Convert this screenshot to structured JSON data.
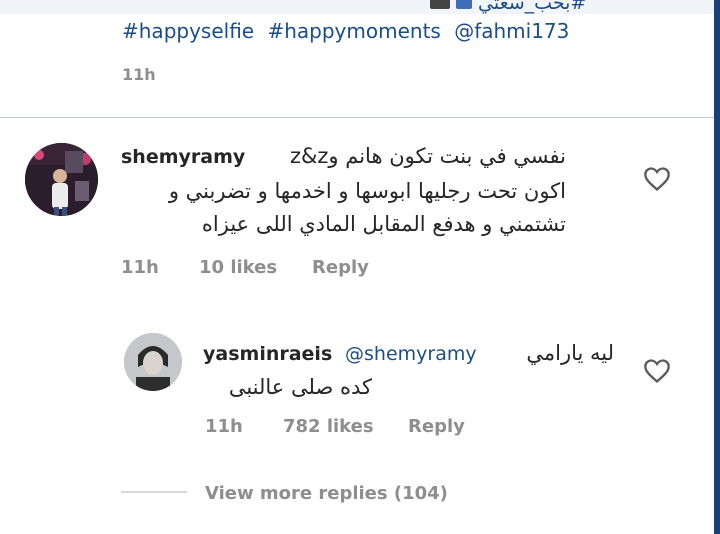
{
  "caption": {
    "top_text": "#بحب_سعتي",
    "hashtags": [
      "#happyselfie",
      "#happymoments",
      "@fahmi173"
    ],
    "time": "11h"
  },
  "comments": [
    {
      "username": "shemyramy",
      "inline_text": "z&z",
      "lines": [
        "نفسي في بنت تكون هانم و",
        "اكون تحت رجليها ابوسها و اخدمها و تضربني و",
        "تشتمني و هدفع المقابل المادي اللى عيزاه"
      ],
      "time": "11h",
      "likes": "10 likes",
      "reply_label": "Reply"
    },
    {
      "username": "yasminraeis",
      "mention": "@shemyramy",
      "lines": [
        "ليه يارامي",
        "كده صلى عالنبى"
      ],
      "time": "11h",
      "likes": "782 likes",
      "reply_label": "Reply"
    }
  ],
  "view_more": "View more replies (104)",
  "colors": {
    "link": "#1b4d89",
    "meta": "#8e8e8e",
    "text": "#262626",
    "divider": "#c4c9cf"
  },
  "icons": [
    "film-emoji-icon",
    "emoji-icon",
    "heart-icon"
  ]
}
